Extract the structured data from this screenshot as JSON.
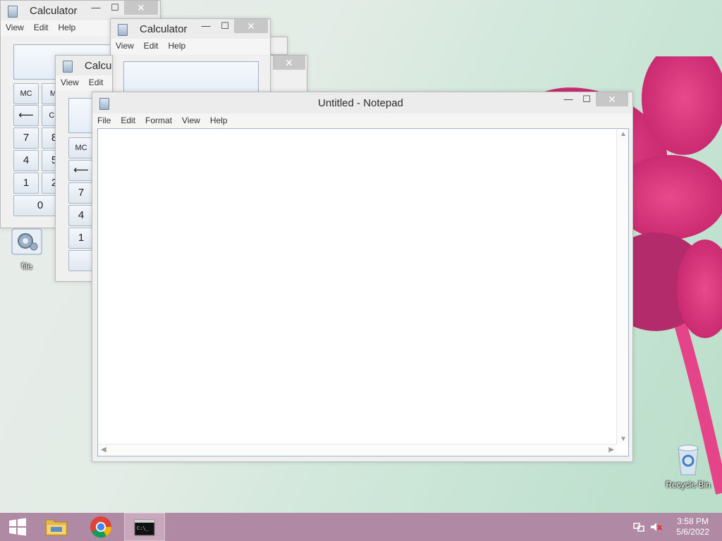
{
  "calc1": {
    "title": "Calculator",
    "menu": [
      "View",
      "Edit",
      "Help"
    ],
    "buttons": [
      "MC",
      "MI",
      "⟵",
      "CE",
      "7",
      "8",
      "4",
      "5",
      "1",
      "2",
      "0"
    ]
  },
  "calc2": {
    "title": "Calculator",
    "menu": [
      "View",
      "Edit",
      "Help"
    ]
  },
  "calc3": {
    "title": "Calcu",
    "menu": [
      "View",
      "Edit"
    ],
    "buttons": [
      "MC",
      "⟵",
      "7",
      "4",
      "1"
    ]
  },
  "notepad": {
    "title": "Untitled - Notepad",
    "menu": [
      "File",
      "Edit",
      "Format",
      "View",
      "Help"
    ],
    "content": ""
  },
  "window_controls": {
    "minimize": "—",
    "maximize": "☐",
    "close": "✕"
  },
  "desktop": {
    "icons": [
      {
        "label": "file",
        "icon": "settings-gear-icon"
      },
      {
        "label": "Recycle Bin",
        "icon": "recycle-bin-icon"
      }
    ]
  },
  "taskbar": {
    "items": [
      {
        "name": "start",
        "icon": "windows-logo-icon"
      },
      {
        "name": "file-explorer",
        "icon": "folder-icon"
      },
      {
        "name": "chrome",
        "icon": "chrome-icon"
      },
      {
        "name": "command-prompt",
        "icon": "cmd-icon",
        "active": true
      }
    ],
    "tray": {
      "icons": [
        "network-icon",
        "speaker-muted-icon"
      ],
      "time": "3:58 PM",
      "date": "5/6/2022"
    }
  },
  "colors": {
    "taskbar": "#b08aa4",
    "close_button": "#c7c7c7",
    "accent_flower": "#d9357a"
  }
}
